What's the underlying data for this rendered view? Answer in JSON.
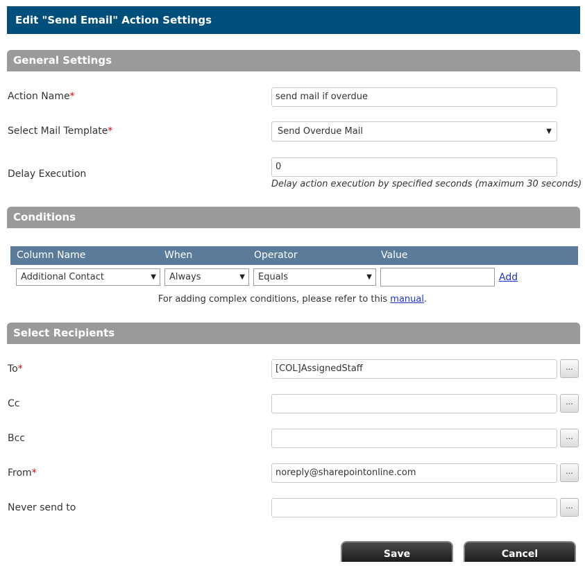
{
  "dialog": {
    "title": "Edit \"Send Email\" Action Settings"
  },
  "general": {
    "heading": "General Settings",
    "action_name_label": "Action Name",
    "action_name_value": "send mail if overdue",
    "mail_template_label": "Select Mail Template",
    "mail_template_value": "Send Overdue Mail",
    "delay_label": "Delay Execution",
    "delay_value": "0",
    "delay_hint": "Delay action execution by specified seconds (maximum 30 seconds)"
  },
  "conditions": {
    "heading": "Conditions",
    "columns": [
      "Column Name",
      "When",
      "Operator",
      "Value"
    ],
    "column_name_value": "Additional Contact",
    "when_value": "Always",
    "operator_value": "Equals",
    "value_value": "",
    "add_label": "Add",
    "note_prefix": "For adding complex conditions, please refer to this ",
    "note_link": "manual",
    "note_suffix": "."
  },
  "recipients": {
    "heading": "Select Recipients",
    "to_label": "To",
    "to_value": "[COL]AssignedStaff",
    "cc_label": "Cc",
    "cc_value": "",
    "bcc_label": "Bcc",
    "bcc_value": "",
    "from_label": "From",
    "from_value": "noreply@sharepointonline.com",
    "never_label": "Never send to",
    "never_value": "",
    "picker_label": "..."
  },
  "required_marker": "*",
  "dropdown_arrow": "▼",
  "buttons": {
    "save": "Save",
    "cancel": "Cancel"
  }
}
